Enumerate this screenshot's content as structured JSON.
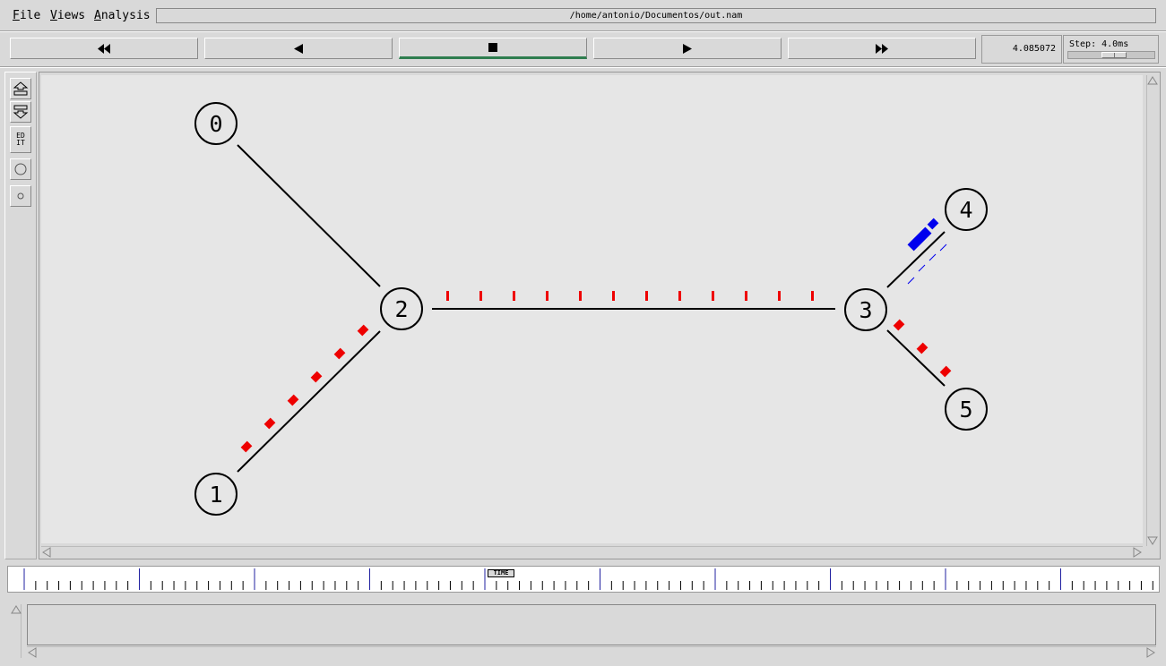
{
  "menu": {
    "file": {
      "first": "F",
      "rest": "ile"
    },
    "views": {
      "first": "V",
      "rest": "iews"
    },
    "analysis": {
      "first": "A",
      "rest": "nalysis"
    }
  },
  "window": {
    "title": "/home/antonio/Documentos/out.nam"
  },
  "playback": {
    "rewind_icon": "fast-rewind-icon",
    "back_icon": "play-backward-icon",
    "stop_icon": "stop-icon",
    "play_icon": "play-forward-icon",
    "ffwd_icon": "fast-forward-icon",
    "current_time": "4.085072",
    "step_label": "Step: 4.0ms",
    "step_slider_fraction": 0.55
  },
  "tools": {
    "zoom_in_icon": "zoom-in-icon",
    "zoom_out_icon": "zoom-out-icon",
    "edit_line1": "ED",
    "edit_line2": "IT",
    "node_large_icon": "circle-large-icon",
    "node_small_icon": "circle-small-icon"
  },
  "network": {
    "nodes": [
      {
        "id": "0"
      },
      {
        "id": "1"
      },
      {
        "id": "2"
      },
      {
        "id": "3"
      },
      {
        "id": "4"
      },
      {
        "id": "5"
      }
    ],
    "links": [
      {
        "from": "0",
        "to": "2"
      },
      {
        "from": "1",
        "to": "2"
      },
      {
        "from": "2",
        "to": "3"
      },
      {
        "from": "3",
        "to": "4"
      },
      {
        "from": "3",
        "to": "5"
      }
    ],
    "packet_colors": {
      "red": "#ee0000",
      "blue": "#0000ee"
    }
  },
  "timeline": {
    "label": "TIME"
  }
}
